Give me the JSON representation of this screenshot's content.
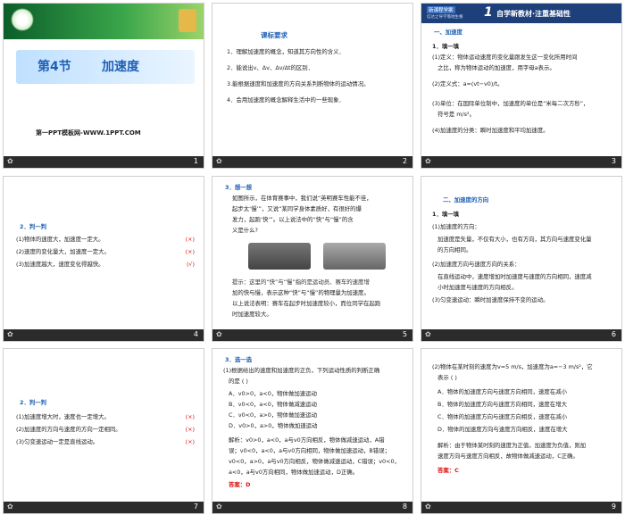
{
  "s1": {
    "title_num": "第4节",
    "title": "加速度",
    "footer": "第一PPT模板网-WWW.1PPT.COM",
    "page": "1"
  },
  "s2": {
    "heading": "课标要求",
    "items": [
      "1．理解加速度的概念，知道其方向性的含义．",
      "2．能说出v、Δv、Δv/Δt的区别．",
      "3.能根据速度和加速度的方向关系判断物体的运动情况。",
      "4．会用加速度的概念解释生活中的一些现象．"
    ],
    "page": "2"
  },
  "s3": {
    "tag1": "新课程学案",
    "tag2": "信达之导学落地生根",
    "section_num": "1",
    "section_title": "自学新教材·注重基础性",
    "sub": "一、加速度",
    "fill_label": "1．填一填",
    "lines": [
      "(1)定义：物体运动速度的变化量跟发生这一变化所用时间",
      "之比，称为物体运动的加速度，用字母a表示。",
      "(2)定义式：a=(vt−v0)/t。",
      "(3)单位：在国际单位制中，加速度的单位是“米每二次方秒”，",
      "符号是 m/s²。",
      "(4)加速度的分类：瞬时加速度和平均加速度。"
    ],
    "page": "3"
  },
  "s4": {
    "label": "2．判一判",
    "items": [
      {
        "t": "(1)物体的速度大，加速度一定大。",
        "m": "(×)"
      },
      {
        "t": "(2)速度的变化量大，加速度一定大。",
        "m": "(×)"
      },
      {
        "t": "(3)加速度越大，速度变化得越快。",
        "m": "(√)"
      }
    ],
    "page": "4"
  },
  "s5": {
    "label": "3．想一想",
    "q": [
      "如图所示，在体育赛事中，我们说“英明赛车性能不佳，",
      "起步太‘慢’”，又说“某同学身体素质好，有很好的爆",
      "发力，起跑‘快’”。以上说法中的“快”与“慢”的含",
      "义是什么?"
    ],
    "ans": [
      "提示：这里的“快”与“慢”指的是运动员、赛车的速度增",
      "加的快与慢，表示这种“快”与“慢”的物理量为加速度。",
      "以上说法表明：赛车在起步时加速度较小，而位同学在起跑",
      "时加速度较大。"
    ],
    "page": "5"
  },
  "s6": {
    "sub": "二、加速度的方向",
    "fill_label": "1．填一填",
    "lines": [
      "(1)加速度的方向：",
      "加速度是矢量，不仅有大小，也有方向，其方向与速度变化量",
      "的方向相同。",
      "(2)加速度方向与速度方向的关系：",
      "在直线运动中，速度增加时加速度与速度的方向相同，速度减",
      "小时加速度与速度的方向相反。",
      "(3)匀变速运动：瞬时加速度保持不变的运动。"
    ],
    "page": "6"
  },
  "s7": {
    "label": "2．判一判",
    "items": [
      {
        "t": "(1)加速度增大时，速度也一定增大。",
        "m": "(×)"
      },
      {
        "t": "(2)加速度的方向与速度的方向一定相同。",
        "m": "(×)"
      },
      {
        "t": "(3)匀变速运动一定是直线运动。",
        "m": "(×)"
      }
    ],
    "page": "7"
  },
  "s8": {
    "label": "3．选一选",
    "q": [
      "(1)根据给出的速度和加速度的正负，下列运动性质的判断正确",
      "的是                                     (    )"
    ],
    "opts": [
      "A．v0>0，a<0，物体做加速运动",
      "B．v0<0，a<0，物体做减速运动",
      "C．v0<0，a>0，物体做加速运动",
      "D．v0>0，a>0，物体做加速运动"
    ],
    "ans": [
      "解析：v0>0，a<0，a与v0方向相反，物体做减速运动，A错",
      "误；v0<0，a<0，a与v0方向相同，物体做加速运动，B错误；",
      "v0<0，a>0，a与v0方向相反，物体做减速运动，C错误；v0<0，",
      "a<0，a与v0方向相同，物体做加速运动，D正确。"
    ],
    "answer": "答案：D",
    "page": "8"
  },
  "s9": {
    "q": [
      "(2)物体在某时刻的速度为v=5 m/s，加速度为a=−3 m/s²，它",
      "表示                                     (    )"
    ],
    "opts": [
      "A．物体的加速度方向与速度方向相同，速度在减小",
      "B．物体的加速度方向与速度方向相同，速度在增大",
      "C．物体的加速度方向与速度方向相反，速度在减小",
      "D．物体的加速度方向与速度方向相反，速度在增大"
    ],
    "ans": [
      "解析：由于物体某时刻的速度为正值，加速度为负值，则加",
      "速度方向与速度方向相反，故物体做减速运动，C正确。"
    ],
    "answer": "答案：C",
    "page": "9"
  }
}
